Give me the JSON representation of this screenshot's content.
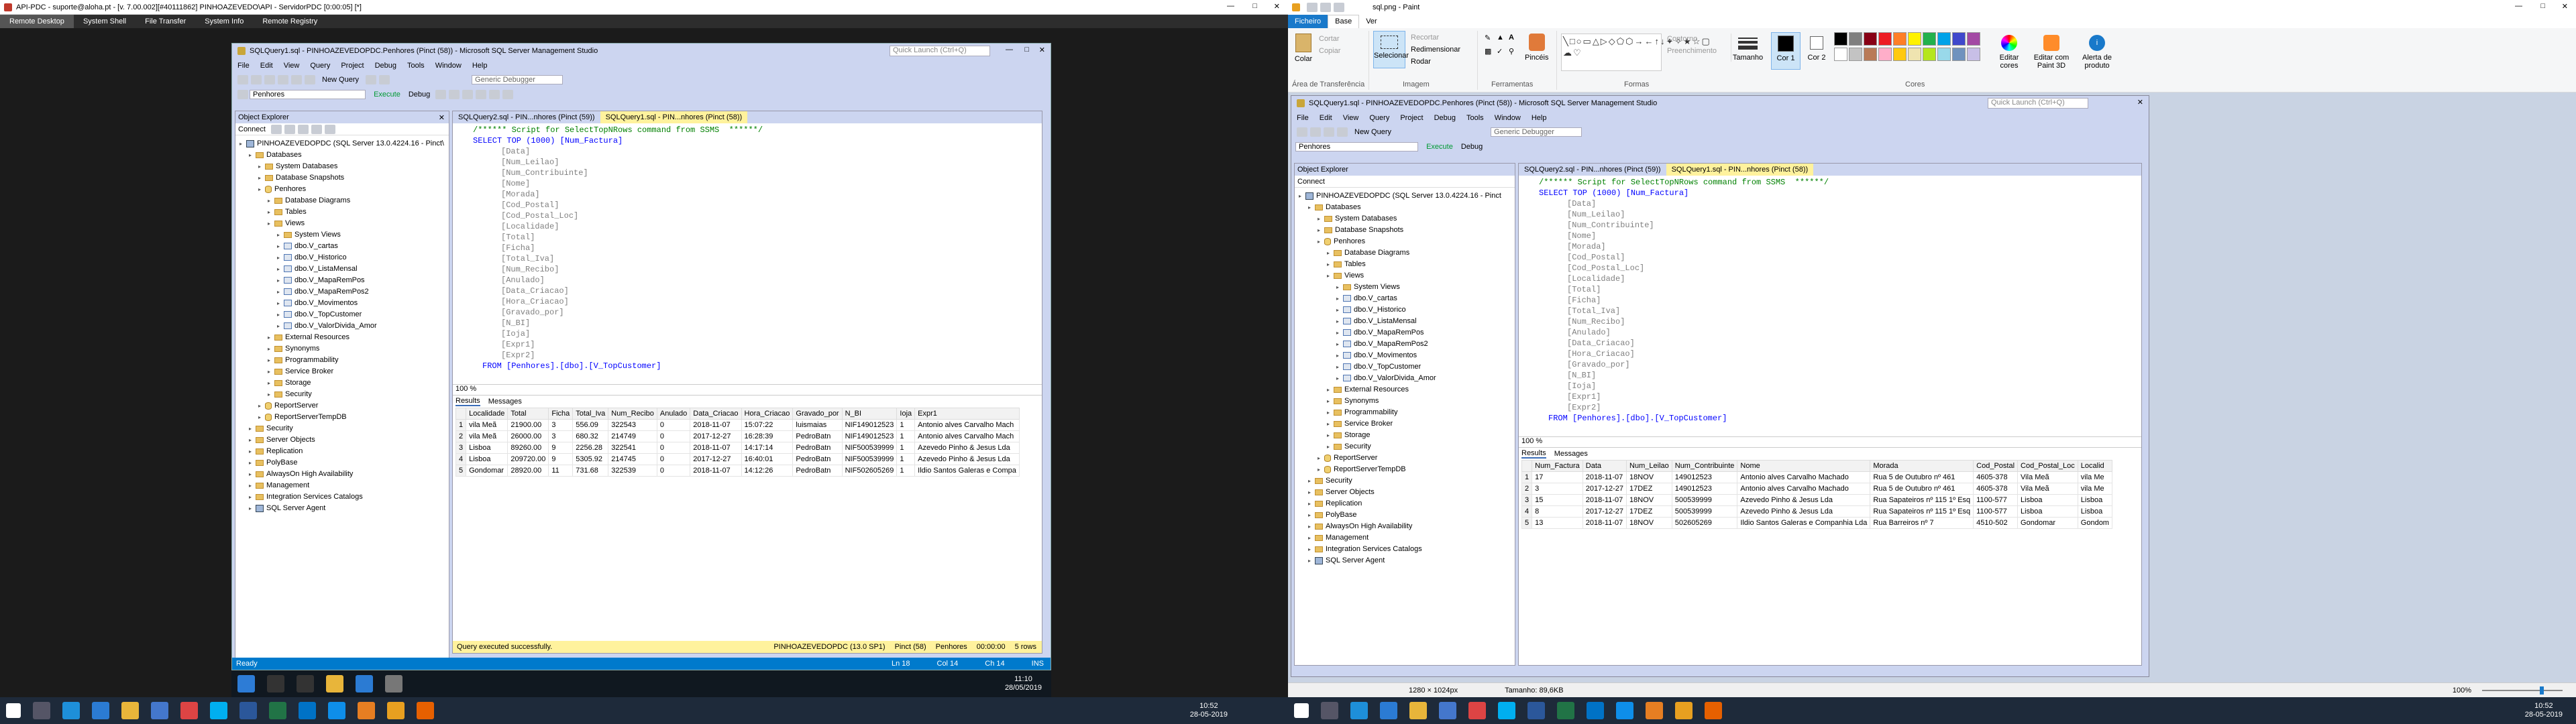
{
  "rdp_title": "API-PDC - suporte@aloha.pt - [v. 7.00.002][#40111862] PINHOAZEVEDO\\API - ServidorPDC [0:00:05] [*]",
  "rdp_tabs": [
    "Remote Desktop",
    "System Shell",
    "File Transfer",
    "System Info",
    "Remote Registry"
  ],
  "ssms": {
    "title": "SQLQuery1.sql - PINHOAZEVEDOPDC.Penhores (Pinct (58)) - Microsoft SQL Server Management Studio",
    "quick_launch": "Quick Launch (Ctrl+Q)",
    "menu": [
      "File",
      "Edit",
      "View",
      "Query",
      "Project",
      "Debug",
      "Tools",
      "Window",
      "Help"
    ],
    "toolbar": {
      "new_query": "New Query",
      "execute": "Execute",
      "debug": "Debug",
      "database": "Penhores",
      "generic_debugger": "Generic Debugger"
    },
    "object_explorer": {
      "title": "Object Explorer",
      "connect": "Connect",
      "tree": [
        {
          "label": "PINHOAZEVEDOPDC (SQL Server 13.0.4224.16 - Pinct\\",
          "icon": "srv",
          "depth": 0
        },
        {
          "label": "Databases",
          "icon": "fold",
          "depth": 1
        },
        {
          "label": "System Databases",
          "icon": "fold",
          "depth": 2
        },
        {
          "label": "Database Snapshots",
          "icon": "fold",
          "depth": 2
        },
        {
          "label": "Penhores",
          "icon": "db",
          "depth": 2
        },
        {
          "label": "Database Diagrams",
          "icon": "fold",
          "depth": 3
        },
        {
          "label": "Tables",
          "icon": "fold",
          "depth": 3
        },
        {
          "label": "Views",
          "icon": "fold",
          "depth": 3
        },
        {
          "label": "System Views",
          "icon": "fold",
          "depth": 4
        },
        {
          "label": "dbo.V_cartas",
          "icon": "view",
          "depth": 4
        },
        {
          "label": "dbo.V_Historico",
          "icon": "view",
          "depth": 4
        },
        {
          "label": "dbo.V_ListaMensal",
          "icon": "view",
          "depth": 4
        },
        {
          "label": "dbo.V_MapaRemPos",
          "icon": "view",
          "depth": 4
        },
        {
          "label": "dbo.V_MapaRemPos2",
          "icon": "view",
          "depth": 4
        },
        {
          "label": "dbo.V_Movimentos",
          "icon": "view",
          "depth": 4
        },
        {
          "label": "dbo.V_TopCustomer",
          "icon": "view",
          "depth": 4
        },
        {
          "label": "dbo.V_ValorDivida_Amor",
          "icon": "view",
          "depth": 4
        },
        {
          "label": "External Resources",
          "icon": "fold",
          "depth": 3
        },
        {
          "label": "Synonyms",
          "icon": "fold",
          "depth": 3
        },
        {
          "label": "Programmability",
          "icon": "fold",
          "depth": 3
        },
        {
          "label": "Service Broker",
          "icon": "fold",
          "depth": 3
        },
        {
          "label": "Storage",
          "icon": "fold",
          "depth": 3
        },
        {
          "label": "Security",
          "icon": "fold",
          "depth": 3
        },
        {
          "label": "ReportServer",
          "icon": "db",
          "depth": 2
        },
        {
          "label": "ReportServerTempDB",
          "icon": "db",
          "depth": 2
        },
        {
          "label": "Security",
          "icon": "fold",
          "depth": 1
        },
        {
          "label": "Server Objects",
          "icon": "fold",
          "depth": 1
        },
        {
          "label": "Replication",
          "icon": "fold",
          "depth": 1
        },
        {
          "label": "PolyBase",
          "icon": "fold",
          "depth": 1
        },
        {
          "label": "AlwaysOn High Availability",
          "icon": "fold",
          "depth": 1
        },
        {
          "label": "Management",
          "icon": "fold",
          "depth": 1
        },
        {
          "label": "Integration Services Catalogs",
          "icon": "fold",
          "depth": 1
        },
        {
          "label": "SQL Server Agent",
          "icon": "srv",
          "depth": 1
        }
      ]
    },
    "tabs": [
      "SQLQuery2.sql - PIN...nhores (Pinct (59))",
      "SQLQuery1.sql - PIN...nhores (Pinct (58))"
    ],
    "code_comment": "/****** Script for SelectTopNRows command from SSMS  ******/",
    "code_select": "SELECT TOP (1000) [Num_Factura]",
    "code_columns": [
      "[Data]",
      "[Num_Leilao]",
      "[Num_Contribuinte]",
      "[Nome]",
      "[Morada]",
      "[Cod_Postal]",
      "[Cod_Postal_Loc]",
      "[Localidade]",
      "[Total]",
      "[Ficha]",
      "[Total_Iva]",
      "[Num_Recibo]",
      "[Anulado]",
      "[Data_Criacao]",
      "[Hora_Criacao]",
      "[Gravado_por]",
      "[N_BI]",
      "[Ioja]",
      "[Expr1]",
      "[Expr2]"
    ],
    "code_from": "FROM [Penhores].[dbo].[V_TopCustomer]",
    "zoom": "100 %",
    "results_tab": "Results",
    "messages_tab": "Messages",
    "grid_headers": [
      "",
      "Localidade",
      "Total",
      "Ficha",
      "Total_Iva",
      "Num_Recibo",
      "Anulado",
      "Data_Criacao",
      "Hora_Criacao",
      "Gravado_por",
      "N_BI",
      "Ioja",
      "Expr1"
    ],
    "grid_rows": [
      [
        "1",
        "vila Meã",
        "21900.00",
        "3",
        "556.09",
        "322543",
        "0",
        "2018-11-07",
        "15:07:22",
        "luismaias",
        "NIF149012523",
        "1",
        "Antonio alves Carvalho Mach"
      ],
      [
        "2",
        "vila Meã",
        "26000.00",
        "3",
        "680.32",
        "214749",
        "0",
        "2017-12-27",
        "16:28:39",
        "PedroBatn",
        "NIF149012523",
        "1",
        "Antonio alves Carvalho Mach"
      ],
      [
        "3",
        "Lisboa",
        "89260.00",
        "9",
        "2256.28",
        "322541",
        "0",
        "2018-11-07",
        "14:17:14",
        "PedroBatn",
        "NIF500539999",
        "1",
        "Azevedo Pinho & Jesus Lda"
      ],
      [
        "4",
        "Lisboa",
        "209720.00",
        "9",
        "5305.92",
        "214745",
        "0",
        "2017-12-27",
        "16:40:01",
        "PedroBatn",
        "NIF500539999",
        "1",
        "Azevedo Pinho & Jesus Lda"
      ],
      [
        "5",
        "Gondomar",
        "28920.00",
        "11",
        "731.68",
        "322539",
        "0",
        "2018-11-07",
        "14:12:26",
        "PedroBatn",
        "NIF502605269",
        "1",
        "Ildio Santos Galeras e Compa"
      ]
    ],
    "query_status": "Query executed successfully.",
    "status_server": "PINHOAZEVEDOPDC (13.0 SP1)",
    "status_user": "Pinct (58)",
    "status_db": "Penhores",
    "status_time": "00:00:00",
    "status_rows": "5 rows",
    "ready": "Ready",
    "ln": "Ln 18",
    "col": "Col 14",
    "ch": "Ch 14",
    "ins": "INS"
  },
  "remote_taskbar": {
    "time": "11:10",
    "date": "28/05/2019"
  },
  "paint": {
    "title": "sql.png - Paint",
    "ribbon_tabs": [
      "Ficheiro",
      "Base",
      "Ver"
    ],
    "clipboard": {
      "paste": "Colar",
      "cut": "Cortar",
      "copy": "Copiar",
      "group": "Área de Transferência"
    },
    "image": {
      "select": "Selecionar",
      "crop": "Recortar",
      "resize": "Redimensionar",
      "rotate": "Rodar",
      "group": "Imagem"
    },
    "tools": {
      "brushes": "Pincéis",
      "group": "Ferramentas"
    },
    "shapes": {
      "outline": "Contorno",
      "fill": "Preenchimento",
      "group": "Formas"
    },
    "size": "Tamanho",
    "color1": "Cor 1",
    "color2": "Cor 2",
    "colors_group": "Cores",
    "edit_colors": "Editar cores",
    "paint3d": "Editar com Paint 3D",
    "alert": "Alerta de produto",
    "status_dims": "1280 × 1024px",
    "status_size": "Tamanho: 89,6KB",
    "status_zoom": "100%",
    "palette": [
      "#000000",
      "#7f7f7f",
      "#880015",
      "#ed1c24",
      "#ff7f27",
      "#fff200",
      "#22b14c",
      "#00a2e8",
      "#3f48cc",
      "#a349a4",
      "#ffffff",
      "#c3c3c3",
      "#b97a57",
      "#ffaec9",
      "#ffc90e",
      "#efe4b0",
      "#b5e61d",
      "#99d9ea",
      "#7092be",
      "#c8bfe7"
    ]
  },
  "ssms2": {
    "title": "SQLQuery1.sql - PINHOAZEVEDOPDC.Penhores (Pinct (58)) - Microsoft SQL Server Management Studio",
    "tree_root": "PINHOAZEVEDOPDC (SQL Server 13.0.4224.16 - Pinct",
    "tabs": [
      "SQLQuery2.sql - PIN...nhores (Pinct (59))",
      "SQLQuery1.sql - PIN...nhores (Pinct (58))"
    ],
    "grid_headers": [
      "",
      "Num_Factura",
      "Data",
      "Num_Leilao",
      "Num_Contribuinte",
      "Nome",
      "Morada",
      "Cod_Postal",
      "Cod_Postal_Loc",
      "Localid"
    ],
    "grid_rows": [
      [
        "1",
        "17",
        "2018-11-07",
        "18NOV",
        "149012523",
        "Antonio alves Carvalho Machado",
        "Rua 5 de Outubro nº 461",
        "4605-378",
        "Vila Meã",
        "vila Me"
      ],
      [
        "2",
        "3",
        "2017-12-27",
        "17DEZ",
        "149012523",
        "Antonio alves Carvalho Machado",
        "Rua 5 de Outubro nº 461",
        "4605-378",
        "Vila Meã",
        "vila Me"
      ],
      [
        "3",
        "15",
        "2018-11-07",
        "18NOV",
        "500539999",
        "Azevedo Pinho & Jesus Lda",
        "Rua Sapateiros nº 115 1º Esq",
        "1100-577",
        "Lisboa",
        "Lisboa"
      ],
      [
        "4",
        "8",
        "2017-12-27",
        "17DEZ",
        "500539999",
        "Azevedo Pinho & Jesus Lda",
        "Rua Sapateiros nº 115 1º Esq",
        "1100-577",
        "Lisboa",
        "Lisboa"
      ],
      [
        "5",
        "13",
        "2018-11-07",
        "18NOV",
        "502605269",
        "Ildio Santos Galeras e Companhia Lda",
        "Rua Barreiros nº 7",
        "4510-502",
        "Gondomar",
        "Gondom"
      ]
    ]
  },
  "host_taskbar": {
    "time": "10:52",
    "date": "28-05-2019",
    "time2": "10:52",
    "date2": "28-05-2019"
  }
}
